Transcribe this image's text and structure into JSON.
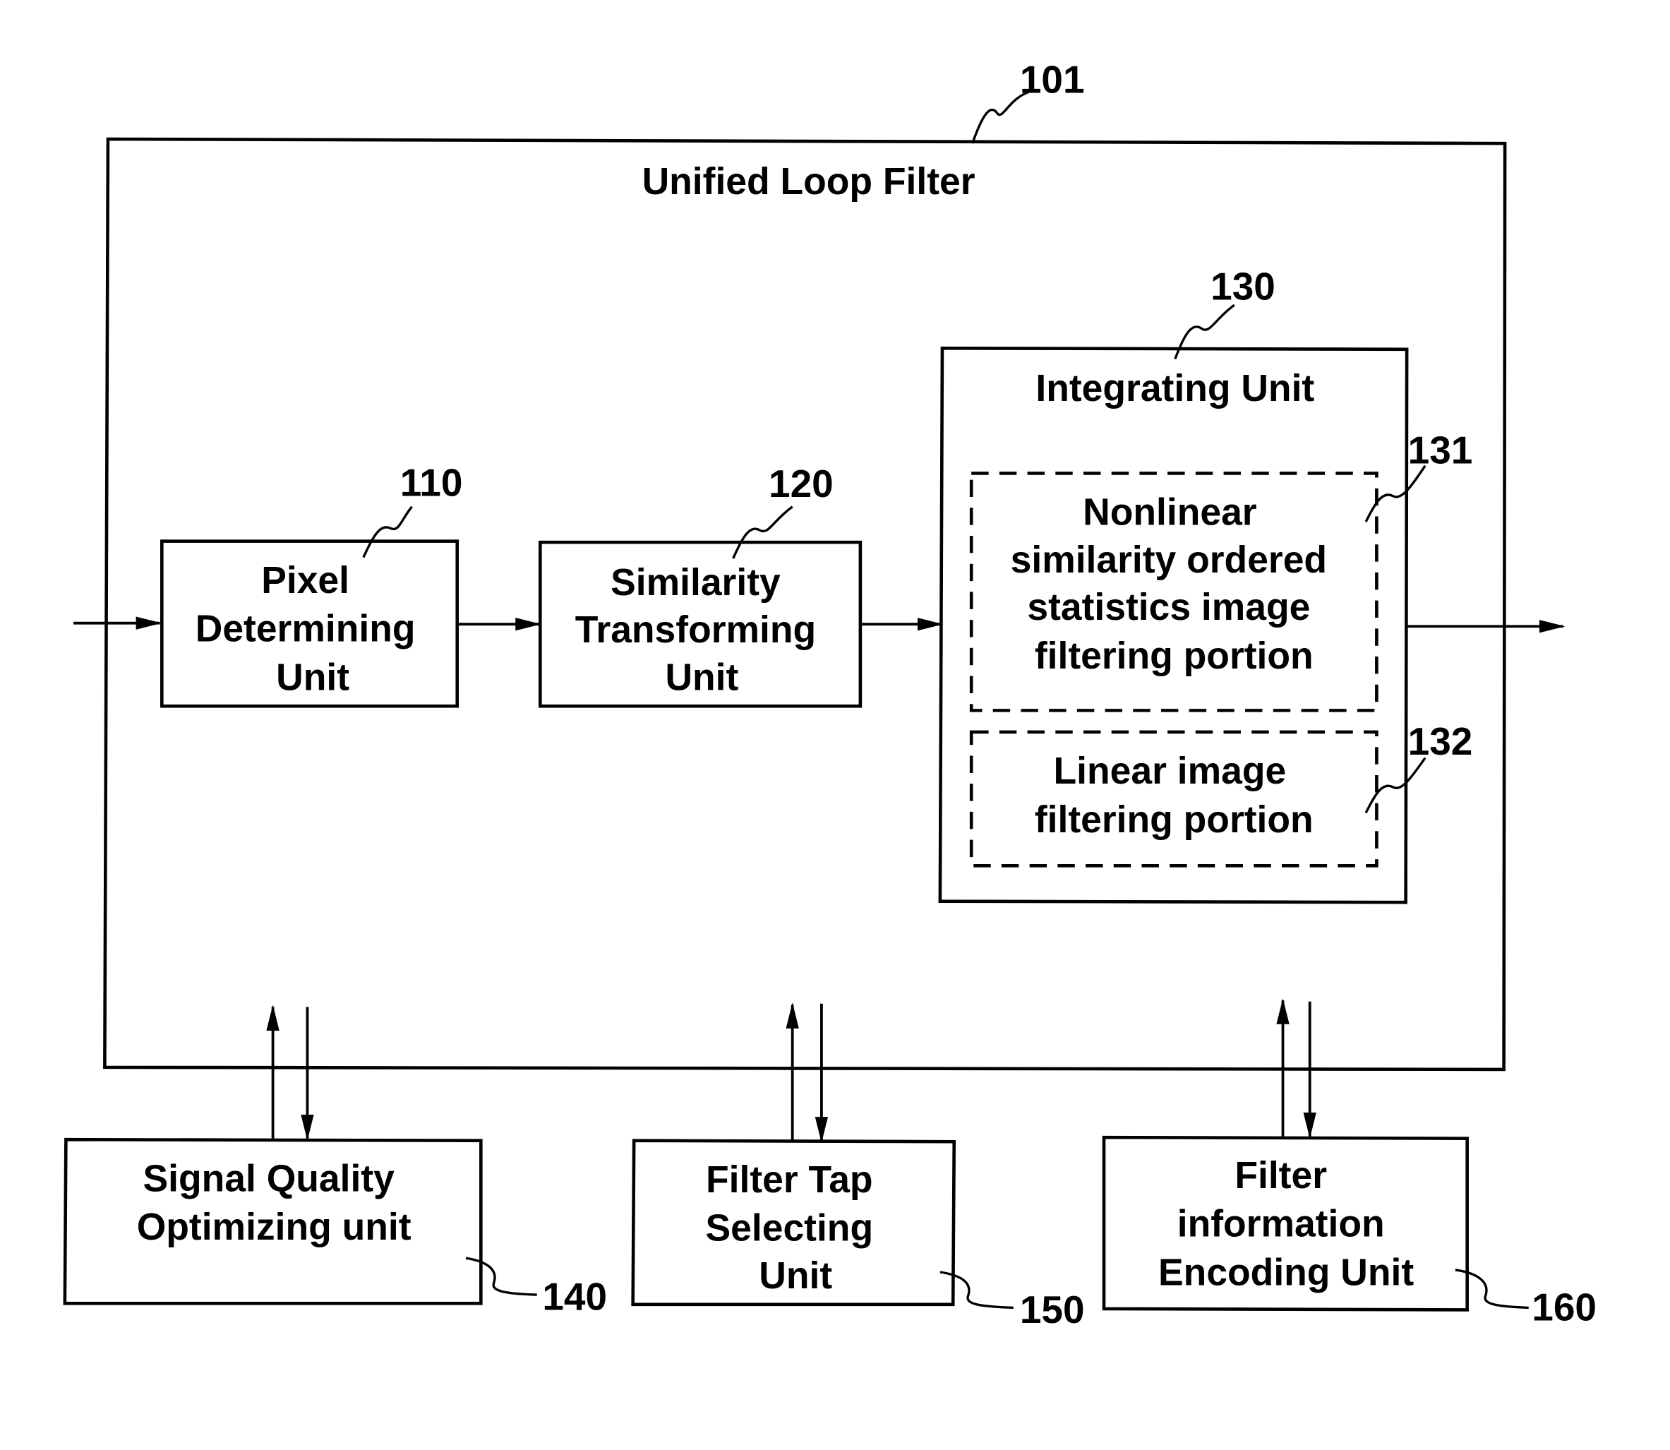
{
  "figure": {
    "outer": {
      "title": "Unified Loop Filter",
      "ref": "101"
    },
    "blocks": [
      {
        "id": "pixel",
        "lines": [
          "Pixel",
          "Determining",
          "Unit"
        ],
        "ref": "110"
      },
      {
        "id": "similarity",
        "lines": [
          "Similarity",
          "Transforming",
          "Unit"
        ],
        "ref": "120"
      },
      {
        "id": "integrating",
        "lines": [
          "Integrating Unit"
        ],
        "ref": "130"
      },
      {
        "id": "nonlinear",
        "lines": [
          "Nonlinear",
          "similarity ordered",
          "statistics image",
          "filtering portion"
        ],
        "ref": "131"
      },
      {
        "id": "linear",
        "lines": [
          "Linear image",
          "filtering portion"
        ],
        "ref": "132"
      },
      {
        "id": "signal",
        "lines": [
          "Signal Quality",
          "Optimizing unit"
        ],
        "ref": "140"
      },
      {
        "id": "filtertap",
        "lines": [
          "Filter Tap",
          "Selecting",
          "Unit"
        ],
        "ref": "150"
      },
      {
        "id": "filterinfo",
        "lines": [
          "Filter",
          "information",
          "Encoding Unit"
        ],
        "ref": "160"
      }
    ]
  }
}
